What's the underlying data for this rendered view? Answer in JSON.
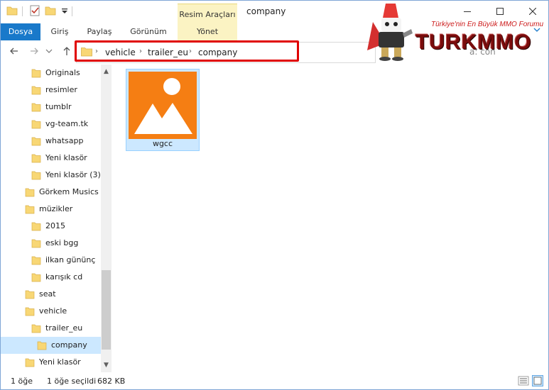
{
  "window": {
    "title": "company",
    "contextual_tab_group": "Resim Araçları",
    "controls": [
      "minimize",
      "maximize",
      "close"
    ]
  },
  "ribbon": {
    "tabs": [
      "Dosya",
      "Giriş",
      "Paylaş",
      "Görünüm",
      "Yönet"
    ]
  },
  "address": {
    "breadcrumbs": [
      "vehicle",
      "trailer_eu",
      "company"
    ],
    "search_partial": "a: con"
  },
  "banner": {
    "tagline": "Türkiye'nin En Büyük MMO Forumu",
    "logo_text": "TURKMMO"
  },
  "nav_tree": [
    {
      "label": "Originals",
      "indent": 2
    },
    {
      "label": "resimler",
      "indent": 2
    },
    {
      "label": "tumblr",
      "indent": 2
    },
    {
      "label": "vg-team.tk",
      "indent": 2
    },
    {
      "label": "whatsapp",
      "indent": 2
    },
    {
      "label": "Yeni klasör",
      "indent": 2
    },
    {
      "label": "Yeni klasör (3)",
      "indent": 2
    },
    {
      "label": "Görkem Musics",
      "indent": 1
    },
    {
      "label": "müzikler",
      "indent": 1
    },
    {
      "label": "2015",
      "indent": 2
    },
    {
      "label": "eski bgg",
      "indent": 2
    },
    {
      "label": "ilkan gününç",
      "indent": 2
    },
    {
      "label": "karışık cd",
      "indent": 2
    },
    {
      "label": "seat",
      "indent": 1
    },
    {
      "label": "vehicle",
      "indent": 1
    },
    {
      "label": "trailer_eu",
      "indent": 2
    },
    {
      "label": "company",
      "indent": 3,
      "selected": true
    },
    {
      "label": "Yeni klasör",
      "indent": 1
    }
  ],
  "files": [
    {
      "name": "wgcc",
      "type": "image",
      "selected": true
    }
  ],
  "status": {
    "count": "1 öğe",
    "selection": "1 öğe seçildi",
    "size": "682 KB"
  },
  "colors": {
    "file_tab": "#1979ca",
    "context_tab": "#fbf3c3",
    "selection": "#cce8ff",
    "thumbnail": "#f57e13",
    "folder": "#f8d775",
    "highlight_box": "#e00000"
  },
  "icons": {
    "back": "arrow-left-icon",
    "forward": "arrow-right-icon",
    "recent": "chevron-down-icon",
    "up": "arrow-up-icon",
    "folder": "folder-icon",
    "details_view": "details-view-icon",
    "large_icons_view": "large-icons-view-icon"
  }
}
